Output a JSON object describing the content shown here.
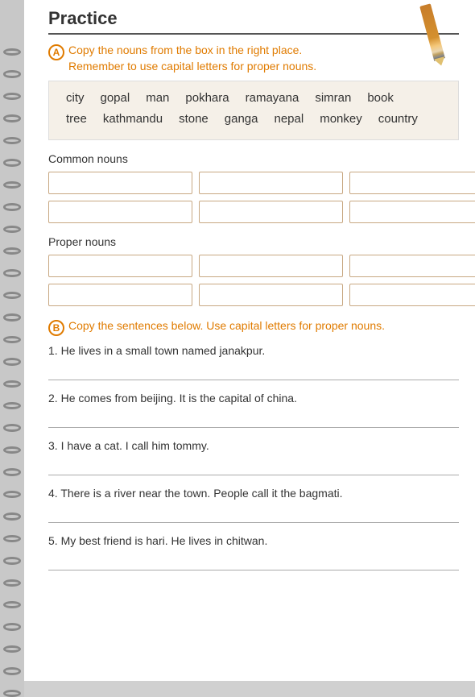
{
  "page": {
    "title": "Practice"
  },
  "sectionA": {
    "circle_label": "A",
    "instruction_line1": "Copy the nouns from the box in the right place.",
    "instruction_line2": "Remember to use capital letters for proper nouns.",
    "word_rows": [
      [
        "city",
        "gopal",
        "man",
        "pokhara",
        "ramayana",
        "simran",
        "book"
      ],
      [
        "tree",
        "kathmandu",
        "stone",
        "ganga",
        "nepal",
        "monkey",
        "country"
      ]
    ],
    "common_nouns_label": "Common nouns",
    "proper_nouns_label": "Proper nouns"
  },
  "sectionB": {
    "circle_label": "B",
    "instruction": "Copy the sentences below. Use capital letters for proper nouns.",
    "sentences": [
      {
        "number": "1.",
        "text": "He lives in a small town named janakpur."
      },
      {
        "number": "2.",
        "text": "He comes from beijing. It is the capital of china."
      },
      {
        "number": "3.",
        "text": "I have a cat. I call him tommy."
      },
      {
        "number": "4.",
        "text": "There is a river near the town. People call it the bagmati."
      },
      {
        "number": "5.",
        "text": "My best friend is hari. He lives in chitwan."
      }
    ]
  }
}
